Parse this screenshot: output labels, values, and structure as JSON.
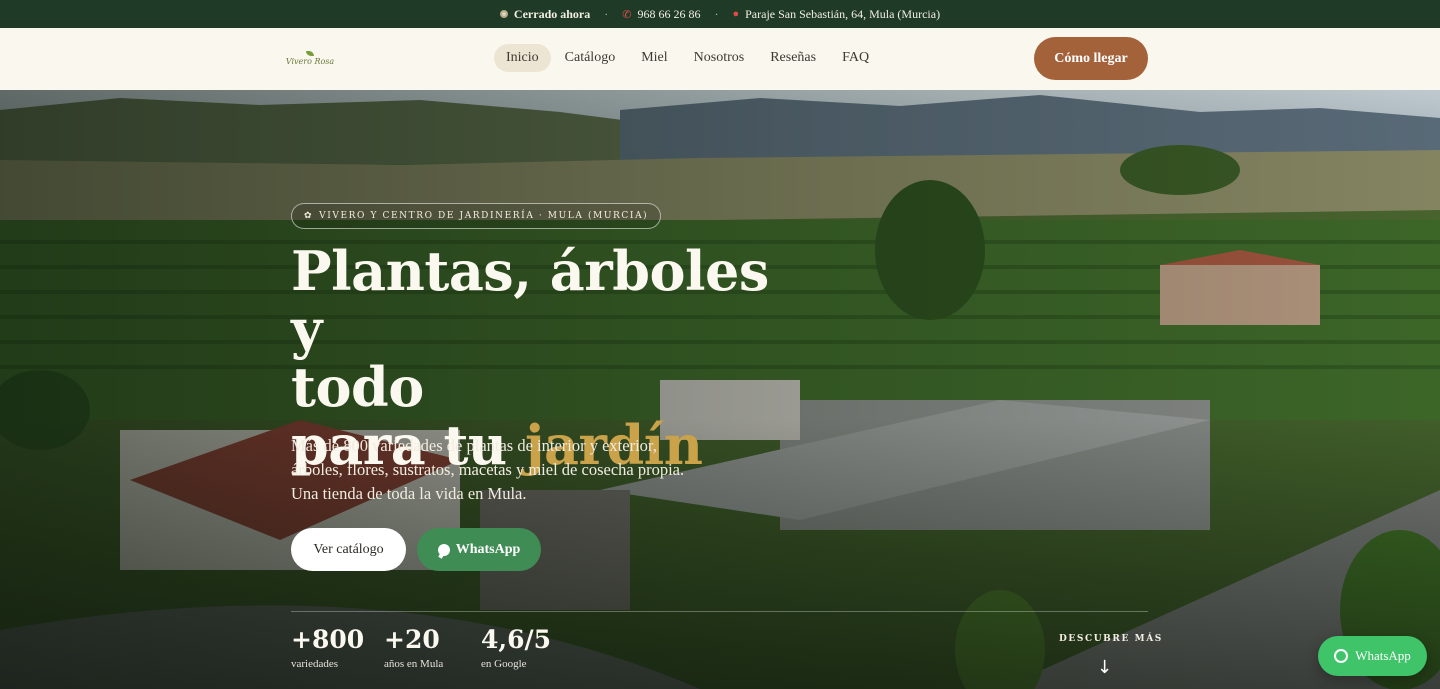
{
  "topbar": {
    "status": "Cerrado ahora",
    "phone": "968 66 26 86",
    "address": "Paraje San Sebastián, 64, Mula (Murcia)",
    "separator": "·"
  },
  "nav": {
    "logo_text": "Vivero Rosa",
    "links": [
      "Inicio",
      "Catálogo",
      "Miel",
      "Nosotros",
      "Reseñas",
      "FAQ"
    ],
    "active": "Inicio",
    "cta": "Cómo llegar"
  },
  "hero": {
    "badge": "VIVERO Y CENTRO DE JARDINERÍA · MULA (MURCIA)",
    "title_line1": "Plantas, árboles y",
    "title_line2": "todo",
    "title_line3_prefix": "para tu ",
    "title_line3_accent": "jardín",
    "subtitle": "Más de 800 variedades de plantas de interior y exterior, árboles, flores, sustratos, macetas y miel de cosecha propia. Una tienda de toda la vida en Mula.",
    "btn_catalog": "Ver catálogo",
    "btn_whatsapp": "WhatsApp",
    "stats": [
      {
        "num": "+800",
        "label": "variedades"
      },
      {
        "num": "+20",
        "label": "años en Mula"
      },
      {
        "num": "4,6/5",
        "label": "en Google"
      }
    ],
    "discover": "DESCUBRE MÁS",
    "discover_arrow": "↓"
  },
  "floating": {
    "whatsapp": "WhatsApp"
  },
  "colors": {
    "topbar_bg": "#1f3a26",
    "nav_bg": "#faf7ee",
    "cta_bg": "#a4623b",
    "accent_gold": "#c9a24a",
    "whatsapp_green": "#3f8c54",
    "float_green": "#3fc46a"
  },
  "icons": {
    "status": "status-dot-icon",
    "phone": "phone-icon",
    "pin": "map-pin-icon",
    "badge": "leaf-icon",
    "whatsapp": "whatsapp-icon"
  }
}
